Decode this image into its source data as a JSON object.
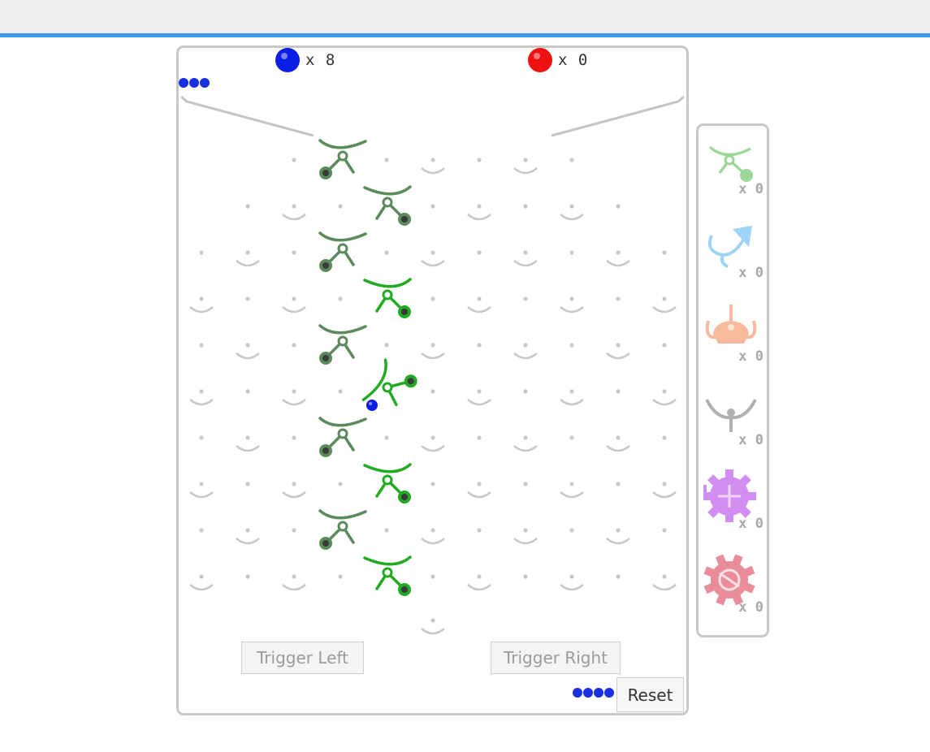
{
  "counters": {
    "blue": {
      "color": "#0a1ee6",
      "label": "x 8"
    },
    "red": {
      "color": "#ee1111",
      "label": "x 0"
    }
  },
  "buttons": {
    "trigger_left": "Trigger Left",
    "trigger_right": "Trigger Right",
    "reset": "Reset"
  },
  "queues": {
    "top_count": 3,
    "bottom_count": 4,
    "ball_color": "#1a2fe0"
  },
  "colors": {
    "bit_fixed": "#5d8a5d",
    "bit_active": "#22aa22",
    "peg": "#c8c8c8",
    "border": "#c8c8c8",
    "accent": "#3d9be9"
  },
  "palette": [
    {
      "name": "bit",
      "icon": "bit-icon",
      "count": "x 0",
      "color": "#9ad89a"
    },
    {
      "name": "crossover",
      "icon": "crossover-icon",
      "count": "x 0",
      "color": "#9dd4f7"
    },
    {
      "name": "interceptor",
      "icon": "interceptor-icon",
      "count": "x 0",
      "color": "#f9b99c"
    },
    {
      "name": "ramp",
      "icon": "ramp-icon",
      "count": "x 0",
      "color": "#b0b0b0"
    },
    {
      "name": "gear-bit",
      "icon": "gear-bit-icon",
      "count": "x 0",
      "color": "#d18ef0"
    },
    {
      "name": "gear",
      "icon": "gear-icon",
      "count": "x 0",
      "color": "#e88d99"
    }
  ]
}
